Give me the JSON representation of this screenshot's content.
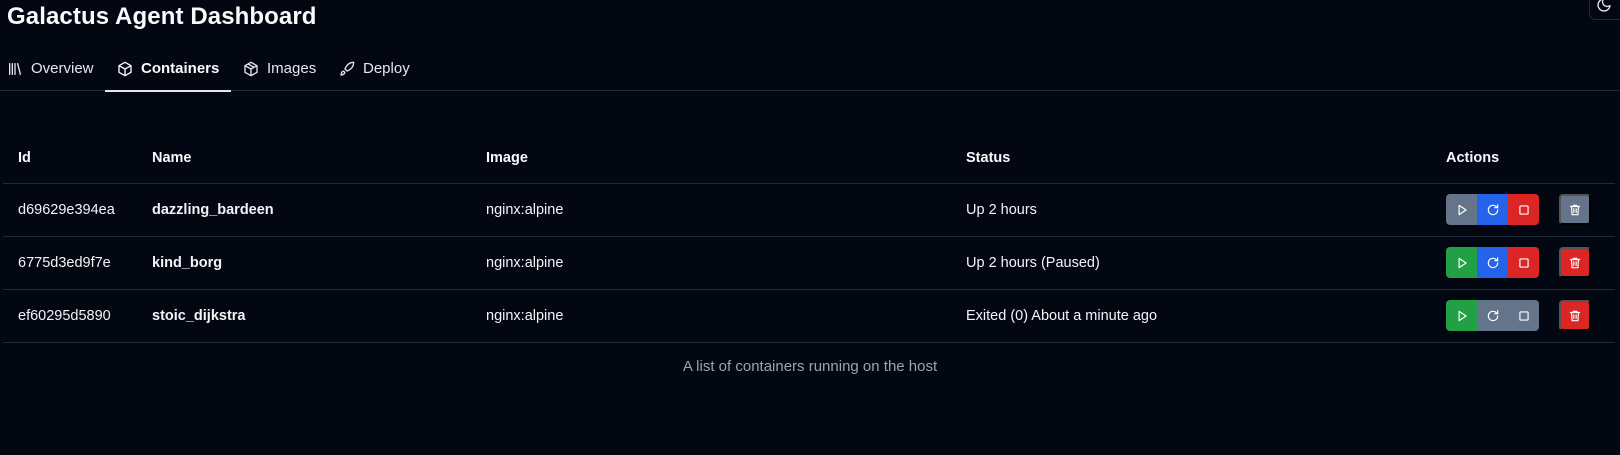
{
  "app": {
    "title": "Galactus Agent Dashboard"
  },
  "tabs": [
    {
      "label": "Overview",
      "icon": "library-icon",
      "active": false
    },
    {
      "label": "Containers",
      "icon": "box-icon",
      "active": true
    },
    {
      "label": "Images",
      "icon": "package-icon",
      "active": false
    },
    {
      "label": "Deploy",
      "icon": "rocket-icon",
      "active": false
    }
  ],
  "table": {
    "headers": [
      "Id",
      "Name",
      "Image",
      "Status",
      "Actions"
    ],
    "rows": [
      {
        "id": "d69629e394ea",
        "name": "dazzling_bardeen",
        "image": "nginx:alpine",
        "status": "Up 2 hours"
      },
      {
        "id": "6775d3ed9f7e",
        "name": "kind_borg",
        "image": "nginx:alpine",
        "status": "Up 2 hours (Paused)"
      },
      {
        "id": "ef60295d5890",
        "name": "stoic_dijkstra",
        "image": "nginx:alpine",
        "status": "Exited (0) About a minute ago"
      }
    ],
    "caption": "A list of containers running on the host"
  },
  "colors": {
    "background": "#030712",
    "disabled": "#64748b",
    "start": "#22a046",
    "restart": "#2563eb",
    "stop": "#dc2626",
    "delete": "#dc2626"
  }
}
